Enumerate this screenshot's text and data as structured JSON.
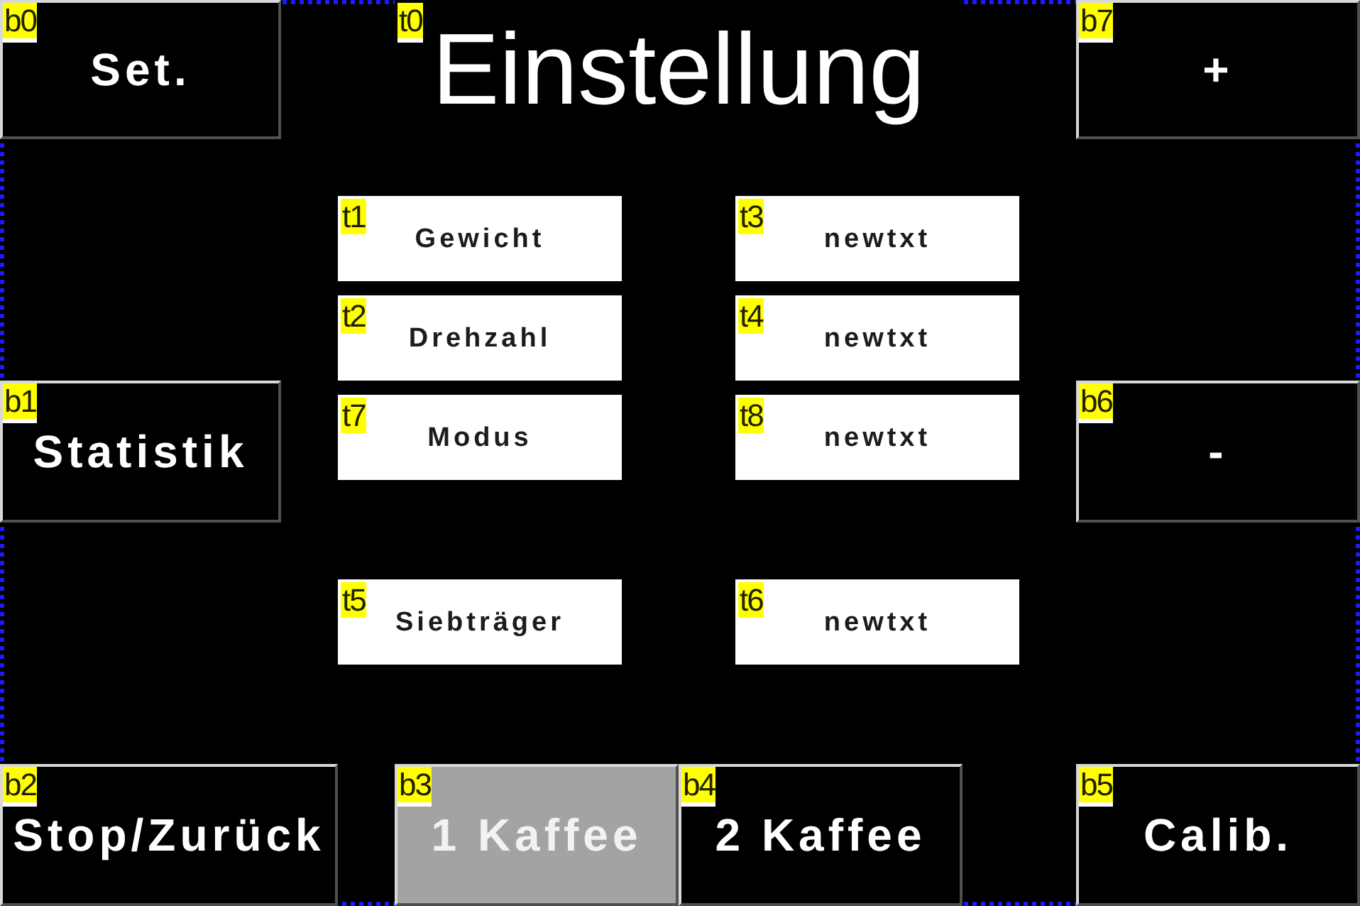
{
  "components": [
    {
      "kind": "button",
      "tag": "b0",
      "text": "Set.",
      "highlighted": false
    },
    {
      "kind": "heading",
      "tag": "t0",
      "text": "Einstellung"
    },
    {
      "kind": "button",
      "tag": "b7",
      "text": "+",
      "highlighted": false
    },
    {
      "kind": "text",
      "tag": "t1",
      "text": "Gewicht"
    },
    {
      "kind": "text",
      "tag": "t3",
      "text": "newtxt"
    },
    {
      "kind": "text",
      "tag": "t2",
      "text": "Drehzahl"
    },
    {
      "kind": "text",
      "tag": "t4",
      "text": "newtxt"
    },
    {
      "kind": "button",
      "tag": "b1",
      "text": "Statistik",
      "highlighted": false
    },
    {
      "kind": "text",
      "tag": "t7",
      "text": "Modus"
    },
    {
      "kind": "text",
      "tag": "t8",
      "text": "newtxt"
    },
    {
      "kind": "button",
      "tag": "b6",
      "text": "-",
      "highlighted": false
    },
    {
      "kind": "text",
      "tag": "t5",
      "text": "Siebträger"
    },
    {
      "kind": "text",
      "tag": "t6",
      "text": "newtxt"
    },
    {
      "kind": "button",
      "tag": "b2",
      "text": "Stop/Zurück",
      "highlighted": false
    },
    {
      "kind": "button",
      "tag": "b3",
      "text": "1 Kaffee",
      "highlighted": true
    },
    {
      "kind": "button",
      "tag": "b4",
      "text": "2 Kaffee",
      "highlighted": false
    },
    {
      "kind": "button",
      "tag": "b5",
      "text": "Calib.",
      "highlighted": false
    }
  ]
}
